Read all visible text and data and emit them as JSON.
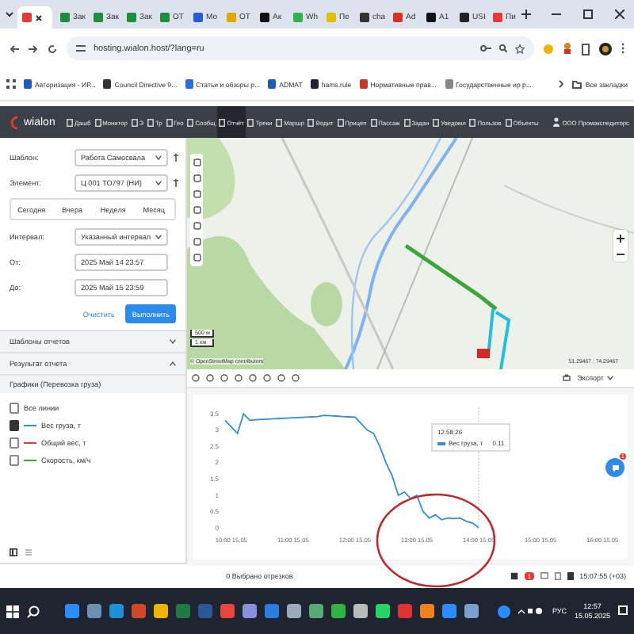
{
  "browser": {
    "tabs": [
      {
        "selected": true
      },
      {
        "label": "Зак",
        "selected": false
      },
      {
        "label": "Зак",
        "selected": false
      },
      {
        "label": "Зак",
        "selected": false
      },
      {
        "label": "ОТ",
        "selected": false
      },
      {
        "label": "Мо",
        "selected": false
      },
      {
        "label": "ОТ",
        "selected": false
      },
      {
        "label": "Ак",
        "selected": false
      },
      {
        "label": "Wh",
        "selected": false
      },
      {
        "label": "Пе",
        "selected": false
      },
      {
        "label": "cha",
        "selected": false
      },
      {
        "label": "Ad",
        "selected": false
      },
      {
        "label": "А1",
        "selected": false
      },
      {
        "label": "USI",
        "selected": false
      },
      {
        "label": "Пи",
        "selected": false
      }
    ],
    "url": "hosting.wialon.host/?lang=ru",
    "bookmarks": [
      "Авторизация - ИР...",
      "Council Directive 9...",
      "Статьи и обзоры р...",
      "ADMAT",
      "hams.rule",
      "Нормативные прав...",
      "Государственные ир р..."
    ],
    "all_bookmarks": "Все закладки"
  },
  "nav": {
    "logo": "wialon",
    "items": [
      {
        "label": "Дашб",
        "selected": false
      },
      {
        "label": "Монитор",
        "selected": false
      },
      {
        "label": "Э",
        "selected": false
      },
      {
        "label": "Тр",
        "selected": false
      },
      {
        "label": "Гео",
        "selected": false
      },
      {
        "label": "Сообщ",
        "selected": false
      },
      {
        "label": "Отчёт",
        "selected": true
      },
      {
        "label": "Треки",
        "selected": false
      },
      {
        "label": "Маршр",
        "selected": false
      },
      {
        "label": "Водит",
        "selected": false
      },
      {
        "label": "Прицеп",
        "selected": false
      },
      {
        "label": "Пассаж",
        "selected": false
      },
      {
        "label": "Задан",
        "selected": false
      },
      {
        "label": "Уведомл",
        "selected": false
      },
      {
        "label": "Пользов",
        "selected": false
      },
      {
        "label": "Объекты",
        "selected": false
      }
    ],
    "account": "ООО Промэкспедиторс"
  },
  "report": {
    "fields": [
      {
        "label": "Шаблон:",
        "value": "Работа Самосвала",
        "kind": "select"
      },
      {
        "label": "Элемент:",
        "value": "Ц 001 ТО797 (НИ)",
        "kind": "select"
      }
    ],
    "periods": [
      {
        "label": "Сегодня",
        "selected": false
      },
      {
        "label": "Вчера",
        "selected": false
      },
      {
        "label": "Неделя",
        "selected": false
      },
      {
        "label": "Месяц",
        "selected": false
      }
    ],
    "interval": {
      "label": "Интервал:",
      "value": "Указанный интервал"
    },
    "from": {
      "label": "От:",
      "value": "2025 Май 14 23:57"
    },
    "to": {
      "label": "До:",
      "value": "2025 Май 15 23:59"
    },
    "buttons": [
      {
        "label": "Очистить",
        "kind": "secondary"
      },
      {
        "label": "Выполнить",
        "kind": "primary"
      }
    ],
    "sections": [
      {
        "label": "Шаблоны отчетов",
        "expanded": false
      },
      {
        "label": "Результат отчета",
        "expanded": true
      }
    ],
    "result_title": "Графики (Перевозка груза)",
    "legend": [
      {
        "label": "Все линии",
        "checked": false
      },
      {
        "label": "Вес груза, т",
        "checked": true,
        "color": "#2f8ee0"
      },
      {
        "label": "Общий вес, т",
        "checked": false,
        "color": "#e03a3a"
      },
      {
        "label": "Скорость, км/ч",
        "checked": false,
        "color": "#3aaa3a"
      }
    ]
  },
  "map": {
    "scale": [
      "500 м",
      "1 км"
    ],
    "attribution": "© OpenStreetMap contributors",
    "coordinates": "51.29467 : 74.29467",
    "export": "Экспорт"
  },
  "chart": {
    "chart_data": {
      "type": "line",
      "categories": [
        null,
        "10:00 15.05",
        null,
        null,
        null,
        null,
        null,
        null,
        null,
        null,
        null,
        "11:00 15.05",
        null,
        null,
        null,
        null,
        null,
        null,
        null,
        null,
        null,
        "12:00 15.05",
        null,
        null,
        null,
        null,
        null,
        null,
        null,
        null,
        null,
        "13:00 15.05",
        null,
        null,
        null,
        null,
        null,
        null,
        null,
        null,
        null,
        "14:00 15.05",
        null,
        null,
        null,
        null,
        null,
        null,
        null,
        null,
        null,
        "15:00 15.05",
        null,
        null,
        null,
        null,
        null,
        null,
        null,
        null,
        null,
        "16:00 15.05",
        null
      ],
      "series": [
        {
          "name": "Вес груза, т",
          "color": "#2f8ee0",
          "values": [
            3.3,
            3.1,
            2.9,
            3.5,
            3.3,
            3.32,
            3.33,
            3.34,
            3.35,
            3.36,
            3.37,
            3.38,
            3.39,
            3.4,
            3.41,
            3.42,
            3.45,
            3.44,
            3.43,
            3.42,
            3.41,
            3.4,
            3.2,
            3.0,
            2.9,
            2.5,
            2.0,
            1.6,
            1.0,
            1.1,
            0.9,
            1.0,
            0.5,
            0.3,
            0.4,
            0.25,
            0.3,
            0.28,
            0.3,
            0.2,
            0.15,
            0.0,
            null,
            null,
            null,
            null,
            null,
            null,
            null,
            null,
            null,
            null,
            null,
            null,
            null,
            null,
            null,
            null,
            null,
            null,
            null,
            null,
            null
          ]
        }
      ],
      "ylim": [
        0,
        3.7
      ],
      "yticks": [
        0,
        0.5,
        1,
        1.5,
        2,
        2.5,
        3,
        3.5
      ]
    },
    "tooltip": {
      "time": "12:58:26",
      "value": "0.11"
    },
    "fab_badge": "1"
  },
  "status": {
    "selection": "0 Выбрано отрезков",
    "badge": "1",
    "time": "15:07:55 (+03)"
  },
  "taskbar": {
    "language": "РУС",
    "time": "12:57",
    "date": "15.05.2025"
  }
}
